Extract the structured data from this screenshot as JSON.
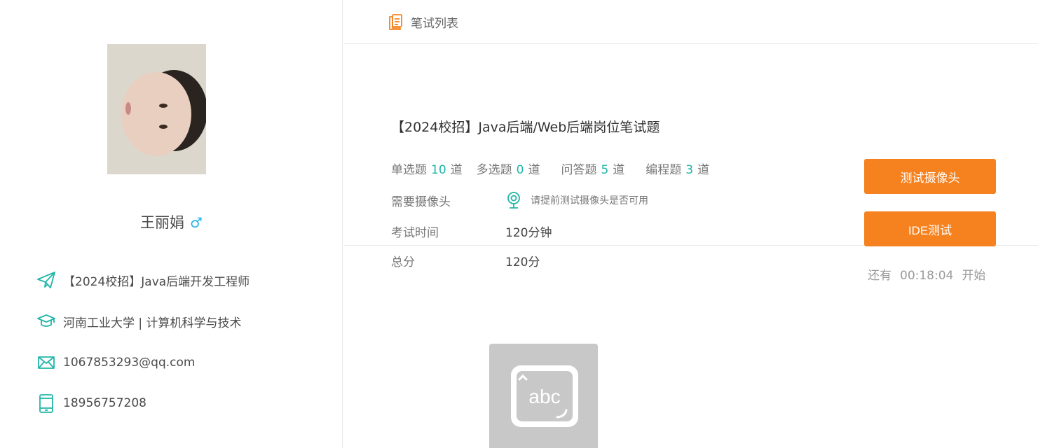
{
  "profile": {
    "name": "王丽娟",
    "gender_symbol": "♂",
    "position": "【2024校招】Java后端开发工程师",
    "education": "河南工业大学 | 计算机科学与技术",
    "email": "1067853293@qq.com",
    "phone": "18956757208"
  },
  "header": {
    "tab_label": "笔试列表"
  },
  "exam": {
    "title": "【2024校招】Java后端/Web后端岗位笔试题",
    "counts": [
      {
        "label": "单选题",
        "num": "10",
        "unit": "道"
      },
      {
        "label": "多选题",
        "num": "0",
        "unit": "道"
      },
      {
        "label": "问答题",
        "num": "5",
        "unit": "道"
      },
      {
        "label": "编程题",
        "num": "3",
        "unit": "道"
      }
    ],
    "camera_label": "需要摄像头",
    "camera_hint": "请提前测试摄像头是否可用",
    "time_label": "考试时间",
    "time_value": "120分钟",
    "score_label": "总分",
    "score_value": "120分",
    "test_camera_button": "测试摄像头",
    "ide_test_button": "IDE测试",
    "countdown_prefix": "还有",
    "countdown_time": "00:18:04",
    "countdown_suffix": "开始"
  },
  "colors": {
    "accent_orange": "#f5821f",
    "accent_teal": "#21b6a8",
    "gender_blue": "#2bb4e8"
  },
  "tile": {
    "text": "abc"
  }
}
